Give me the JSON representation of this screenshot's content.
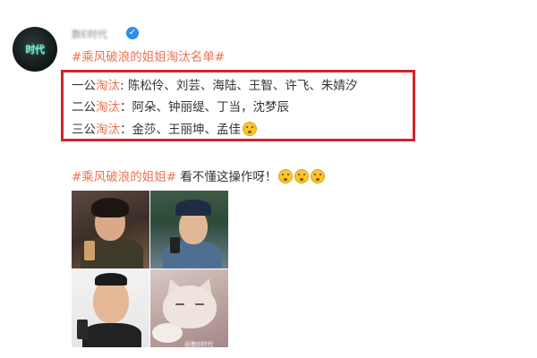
{
  "post": {
    "author": {
      "avatar_text": "时代",
      "name": "数E时代",
      "verified_icon": "verified-badge-icon",
      "verified_glyph": "✓"
    },
    "title_topic": "#乘风破浪的姐姐淘汰名单#",
    "eliminations": [
      {
        "round_label": "一公",
        "tag": "淘汰",
        "sep": ": ",
        "names": "陈松伶、刘芸、海陆、王智、许飞、朱婧汐"
      },
      {
        "round_label": "二公",
        "tag": "淘汰",
        "sep": "：",
        "names": "阿朵、钟丽缇、丁当，沈梦辰"
      },
      {
        "round_label": "三公",
        "tag": "淘汰",
        "sep": "：",
        "names": "金莎、王丽坤、孟佳"
      }
    ],
    "comment_topic": "#乘风破浪的姐姐#",
    "comment_text": " 看不懂这操作呀！",
    "emojis": [
      "shocked-emoji-icon",
      "smirk-emoji-icon",
      "smirk-emoji-icon",
      "smirk-emoji-icon"
    ],
    "images": [
      {
        "name": "photo-woman-reading-phone"
      },
      {
        "name": "photo-man-cap-phone"
      },
      {
        "name": "photo-man-squinting-phone"
      },
      {
        "name": "photo-sleepy-cat"
      }
    ],
    "watermark": "@数E时代"
  },
  "colors": {
    "topic": "#eb7350",
    "highlight_border": "#d2232a",
    "verified": "#2f8ee8"
  }
}
